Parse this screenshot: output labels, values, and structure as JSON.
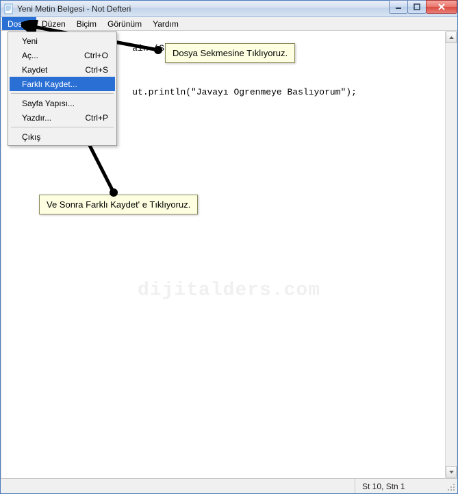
{
  "window": {
    "title": "Yeni Metin Belgesi - Not Defteri"
  },
  "menubar": {
    "items": [
      {
        "label": "Dosya",
        "active": true
      },
      {
        "label": "Düzen",
        "active": false
      },
      {
        "label": "Biçim",
        "active": false
      },
      {
        "label": "Görünüm",
        "active": false
      },
      {
        "label": "Yardım",
        "active": false
      }
    ]
  },
  "dropdown": {
    "items": [
      {
        "label": "Yeni",
        "shortcut": ""
      },
      {
        "label": "Aç...",
        "shortcut": "Ctrl+O"
      },
      {
        "label": "Kaydet",
        "shortcut": "Ctrl+S"
      },
      {
        "label": "Farklı Kaydet...",
        "shortcut": "",
        "highlight": true
      },
      {
        "sep": true
      },
      {
        "label": "Sayfa Yapısı...",
        "shortcut": ""
      },
      {
        "label": "Yazdır...",
        "shortcut": "Ctrl+P"
      },
      {
        "sep": true
      },
      {
        "label": "Çıkış",
        "shortcut": ""
      }
    ]
  },
  "editor": {
    "line1_partial": "ain (String args[]){",
    "line2_partial": "ut.println(\"Javayı Ogrenmeye Baslıyorum\");"
  },
  "callouts": {
    "top": "Dosya Sekmesine Tıklıyoruz.",
    "bottom": "Ve Sonra Farklı Kaydet' e Tıklıyoruz."
  },
  "statusbar": {
    "position": "St 10, Stn 1"
  },
  "watermark": "dijitalders.com",
  "colors": {
    "highlight": "#2a6fd4",
    "callout_bg": "#feffe1"
  }
}
